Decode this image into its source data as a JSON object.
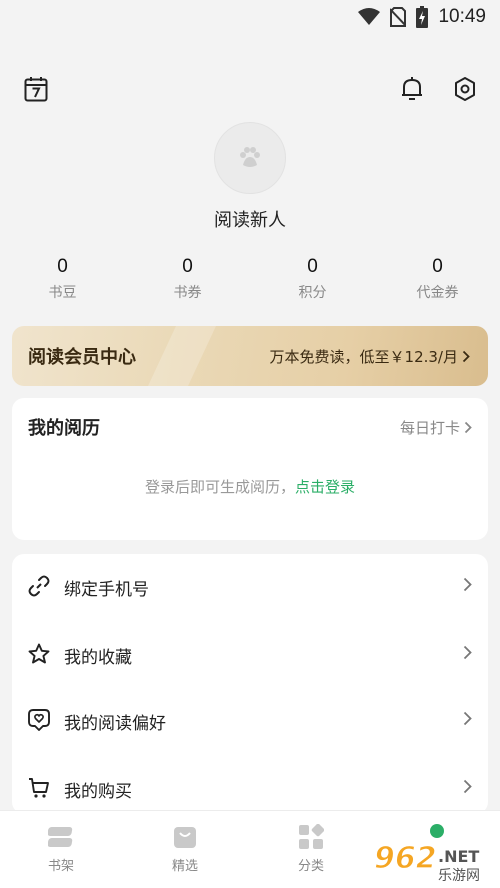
{
  "status_bar": {
    "time": "10:49"
  },
  "profile": {
    "nickname": "阅读新人"
  },
  "stats": [
    {
      "value": "0",
      "label": "书豆"
    },
    {
      "value": "0",
      "label": "书券"
    },
    {
      "value": "0",
      "label": "积分"
    },
    {
      "value": "0",
      "label": "代金券"
    }
  ],
  "vip": {
    "title": "阅读会员中心",
    "promo": "万本免费读，低至￥12.3/月"
  },
  "history": {
    "title": "我的阅历",
    "checkin": "每日打卡",
    "hint": "登录后即可生成阅历，",
    "login_link": "点击登录"
  },
  "menu": [
    {
      "label": "绑定手机号",
      "icon": "link-icon"
    },
    {
      "label": "我的收藏",
      "icon": "star-icon"
    },
    {
      "label": "我的阅读偏好",
      "icon": "heart-badge-icon"
    },
    {
      "label": "我的购买",
      "icon": "cart-icon"
    }
  ],
  "tabs": [
    {
      "label": "书架",
      "icon": "bookshelf-icon"
    },
    {
      "label": "精选",
      "icon": "bag-icon"
    },
    {
      "label": "分类",
      "icon": "category-icon"
    }
  ],
  "watermark": {
    "text": "962.NET",
    "sub": "乐游网"
  },
  "colors": {
    "accent": "#2bae67",
    "vip_gold": "#e6cfa6",
    "background": "#f3f3f3"
  }
}
